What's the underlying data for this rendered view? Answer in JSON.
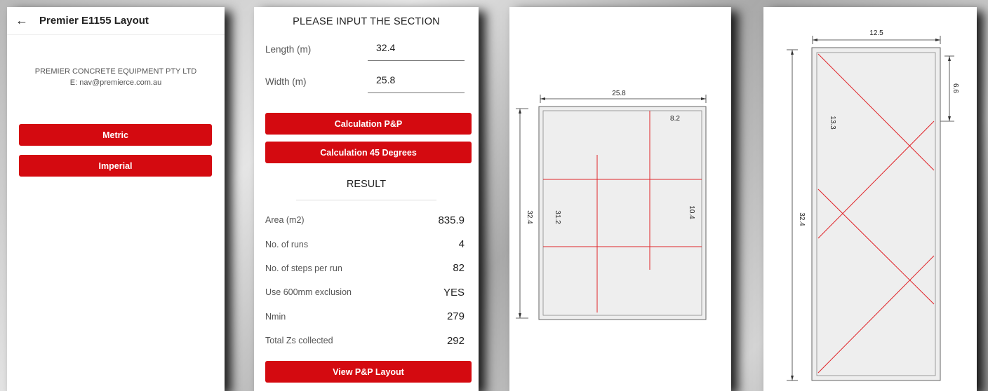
{
  "screen1": {
    "title": "Premier E1155 Layout",
    "company_name": "PREMIER CONCRETE EQUIPMENT PTY LTD",
    "company_email": "E: nav@premierce.com.au",
    "metric_label": "Metric",
    "imperial_label": "Imperial"
  },
  "screen2": {
    "heading": "PLEASE INPUT THE SECTION",
    "length_label": "Length (m)",
    "length_value": "32.4",
    "width_label": "Width (m)",
    "width_value": "25.8",
    "calc_pp_label": "Calculation P&P",
    "calc_45_label": "Calculation 45 Degrees",
    "result_title": "RESULT",
    "results": [
      {
        "label": "Area (m2)",
        "value": "835.9"
      },
      {
        "label": "No. of runs",
        "value": "4"
      },
      {
        "label": "No. of steps per run",
        "value": "82"
      },
      {
        "label": "Use 600mm exclusion",
        "value": "YES"
      },
      {
        "label": "Nmin",
        "value": "279"
      },
      {
        "label": "Total Zs collected",
        "value": "292"
      }
    ],
    "view_layout_label": "View P&P Layout"
  },
  "screen3": {
    "width_dim": "25.8",
    "step_dim": "8.2",
    "length_dim": "32.4",
    "inner_length_dim": "31.2",
    "run_spacing_dim": "10.4"
  },
  "screen4": {
    "width_dim": "12.5",
    "length_dim": "32.4",
    "spacing_dim": "13.3",
    "offset_dim": "6.6"
  },
  "colors": {
    "accent": "#d40a10",
    "layout_line": "#e0262b"
  }
}
